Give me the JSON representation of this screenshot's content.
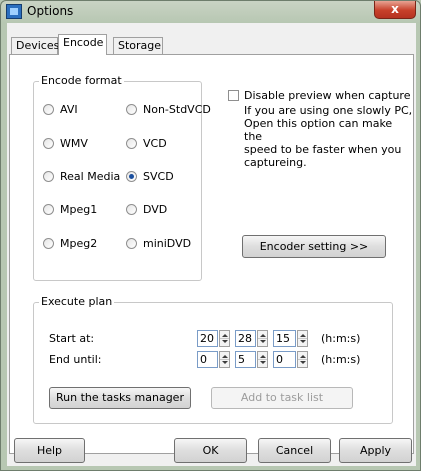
{
  "window": {
    "title": "Options",
    "close_label": "x"
  },
  "tabs": [
    {
      "label": "Devices",
      "active": false
    },
    {
      "label": "Encode",
      "active": true
    },
    {
      "label": "Storage",
      "active": false
    }
  ],
  "encode_format": {
    "title": "Encode format",
    "options": [
      {
        "label": "AVI",
        "selected": false
      },
      {
        "label": "Non-StdVCD",
        "selected": false
      },
      {
        "label": "WMV",
        "selected": false
      },
      {
        "label": "VCD",
        "selected": false
      },
      {
        "label": "Real Media",
        "selected": false
      },
      {
        "label": "SVCD",
        "selected": true
      },
      {
        "label": "Mpeg1",
        "selected": false
      },
      {
        "label": "DVD",
        "selected": false
      },
      {
        "label": "Mpeg2",
        "selected": false
      },
      {
        "label": "miniDVD",
        "selected": false
      }
    ]
  },
  "preview": {
    "checkbox_label": "Disable preview when capture",
    "checked": false,
    "desc_lines": [
      "If you are using one slowly PC,",
      "Open this option can make the",
      "speed  to be faster when you",
      "captureing."
    ]
  },
  "encoder_button": {
    "label": "Encoder setting    >>"
  },
  "execute_plan": {
    "title": "Execute plan",
    "start": {
      "label": "Start  at:",
      "h": "20",
      "m": "28",
      "s": "15",
      "unit": "(h:m:s)"
    },
    "end": {
      "label": "End until:",
      "h": "0",
      "m": "5",
      "s": "0",
      "unit": "(h:m:s)"
    },
    "run_button": "Run the tasks  manager",
    "add_button": "Add to task list"
  },
  "footer": {
    "help": "Help",
    "ok": "OK",
    "cancel": "Cancel",
    "apply": "Apply"
  }
}
